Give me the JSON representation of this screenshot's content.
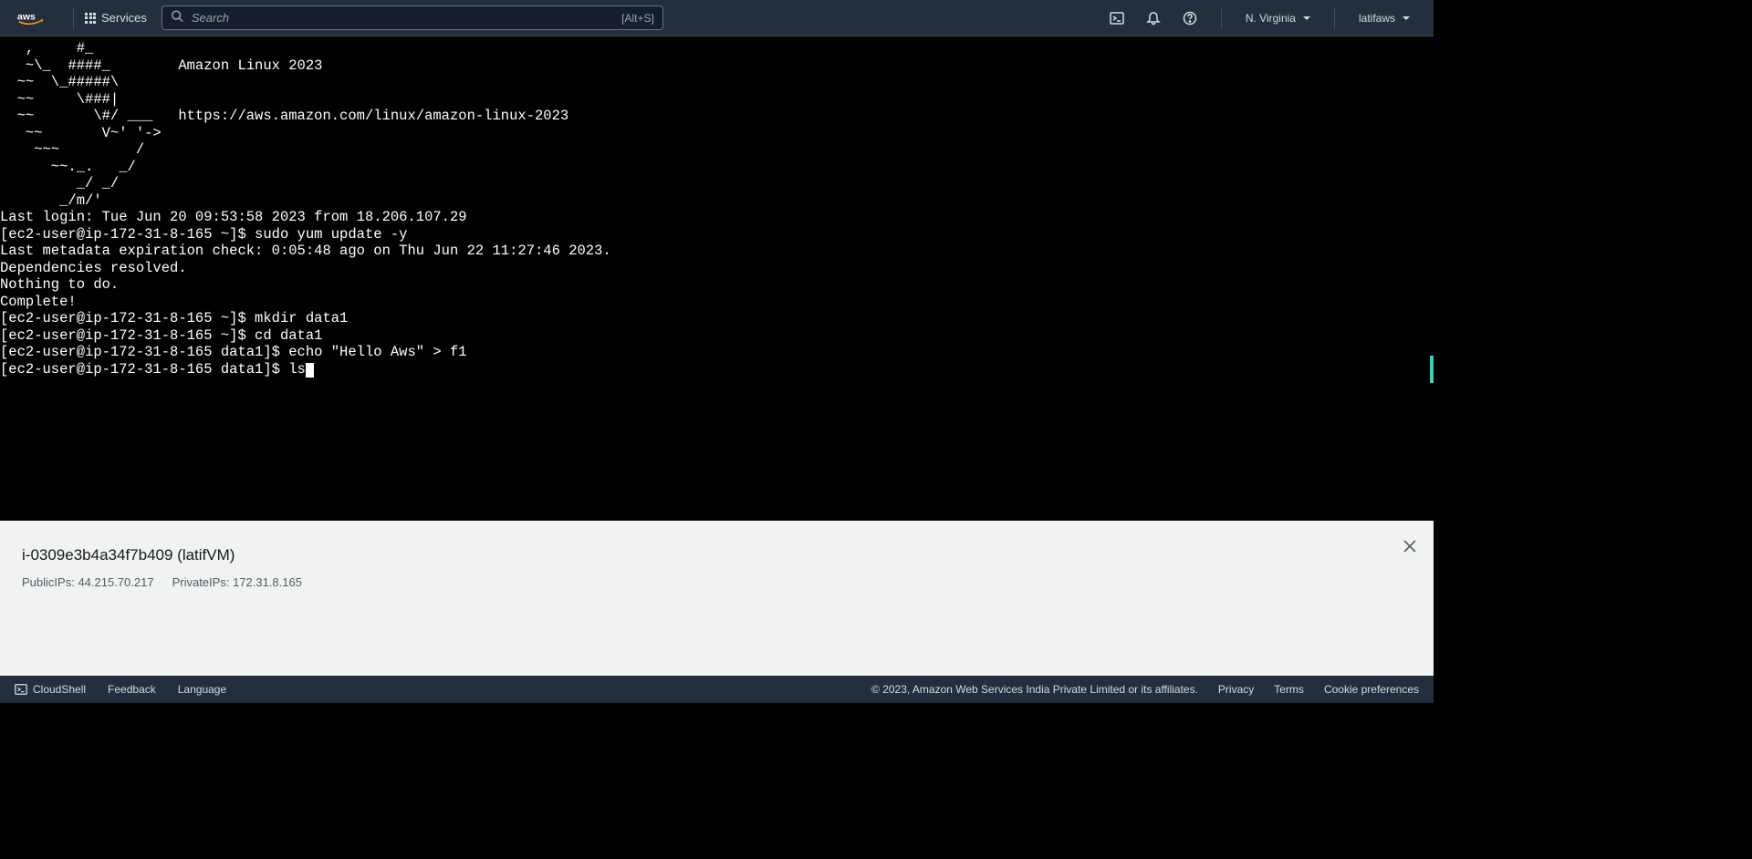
{
  "header": {
    "services_label": "Services",
    "search_placeholder": "Search",
    "search_shortcut": "[Alt+S]",
    "region": "N. Virginia",
    "account": "latifaws"
  },
  "terminal": {
    "motd": "   ,     #_\n   ~\\_  ####_        Amazon Linux 2023\n  ~~  \\_#####\\\n  ~~     \\###|\n  ~~       \\#/ ___   https://aws.amazon.com/linux/amazon-linux-2023\n   ~~       V~' '->\n    ~~~         /\n      ~~._.   _/\n         _/ _/\n       _/m/'",
    "lines": [
      "Last login: Tue Jun 20 09:53:58 2023 from 18.206.107.29",
      "[ec2-user@ip-172-31-8-165 ~]$ sudo yum update -y",
      "Last metadata expiration check: 0:05:48 ago on Thu Jun 22 11:27:46 2023.",
      "Dependencies resolved.",
      "Nothing to do.",
      "Complete!",
      "[ec2-user@ip-172-31-8-165 ~]$ mkdir data1",
      "[ec2-user@ip-172-31-8-165 ~]$ cd data1",
      "[ec2-user@ip-172-31-8-165 data1]$ echo \"Hello Aws\" > f1"
    ],
    "current_prompt": "[ec2-user@ip-172-31-8-165 data1]$ ls"
  },
  "info_panel": {
    "title": "i-0309e3b4a34f7b409 (latifVM)",
    "public_ips_label": "PublicIPs:",
    "public_ips_value": "44.215.70.217",
    "private_ips_label": "PrivateIPs:",
    "private_ips_value": "172.31.8.165"
  },
  "footer": {
    "cloudshell": "CloudShell",
    "feedback": "Feedback",
    "language": "Language",
    "copyright": "© 2023, Amazon Web Services India Private Limited or its affiliates.",
    "privacy": "Privacy",
    "terms": "Terms",
    "cookie": "Cookie preferences"
  }
}
